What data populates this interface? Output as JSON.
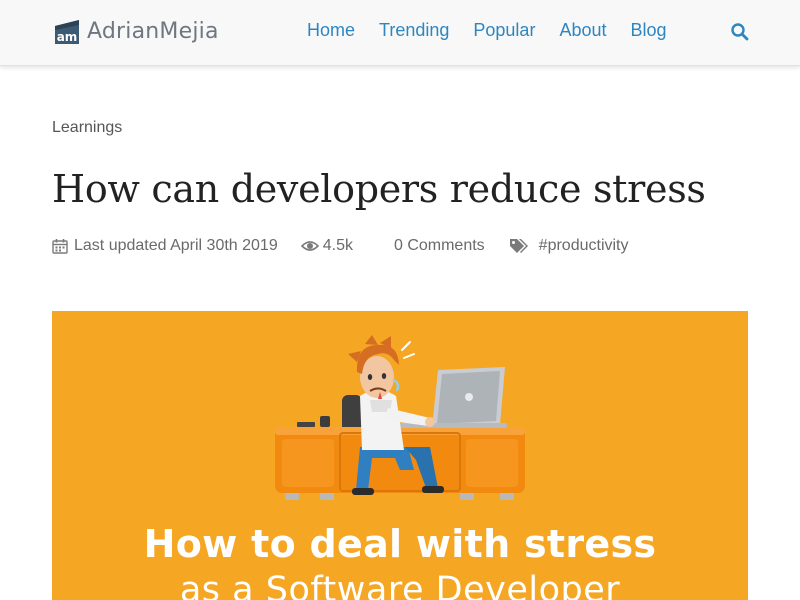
{
  "header": {
    "brand_first": "Adrian",
    "brand_second": "Mejia",
    "logo_icon": "am-monogram-icon",
    "nav": [
      {
        "label": "Home"
      },
      {
        "label": "Trending"
      },
      {
        "label": "Popular"
      },
      {
        "label": "About"
      },
      {
        "label": "Blog"
      }
    ],
    "search_icon": "search-icon"
  },
  "article": {
    "category": "Learnings",
    "title": "How can developers reduce stress",
    "meta": {
      "updated_icon": "calendar-icon",
      "updated": "Last updated April 30th 2019",
      "views_icon": "eye-icon",
      "views": "4.5k",
      "comments": "0 Comments",
      "tags_icon": "tags-icon",
      "tag": "#productivity"
    },
    "hero": {
      "line1": "How to deal with stress",
      "line2": "as a Software Developer"
    }
  },
  "colors": {
    "nav_link": "#2e86c1",
    "hero_background": "#f5a623",
    "desk": "#f28a0f",
    "meta_text": "#6a6a6a"
  }
}
